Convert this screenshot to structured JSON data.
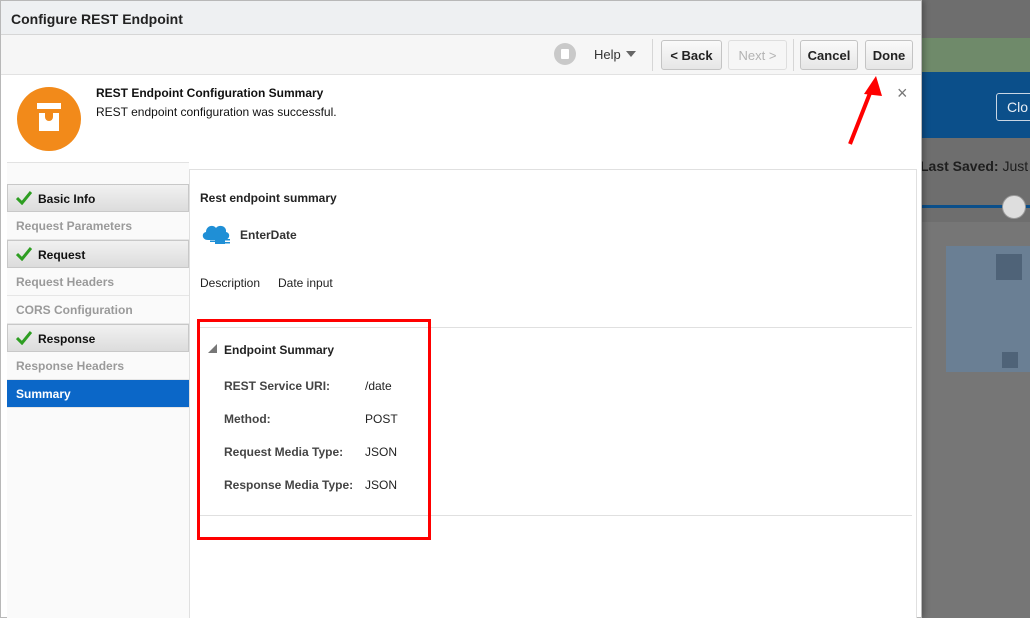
{
  "background": {
    "close_label": "Clo",
    "last_saved_label": "Last Saved:",
    "last_saved_value": "Just n"
  },
  "dialog": {
    "title": "Configure REST Endpoint"
  },
  "toolbar": {
    "help_label": "Help",
    "back_label": "< Back",
    "next_label": "Next >",
    "cancel_label": "Cancel",
    "done_label": "Done"
  },
  "message": {
    "title": "REST Endpoint Configuration Summary",
    "text": "REST endpoint configuration was successful.",
    "close_symbol": "×"
  },
  "sidebar": {
    "items": [
      {
        "label": "Basic Info",
        "state": "done"
      },
      {
        "label": "Request Parameters",
        "state": "pending"
      },
      {
        "label": "Request",
        "state": "done"
      },
      {
        "label": "Request Headers",
        "state": "pending"
      },
      {
        "label": "CORS Configuration",
        "state": "pending"
      },
      {
        "label": "Response",
        "state": "done"
      },
      {
        "label": "Response Headers",
        "state": "pending"
      },
      {
        "label": "Summary",
        "state": "active"
      }
    ]
  },
  "content": {
    "heading": "Rest endpoint summary",
    "endpoint_name": "EnterDate",
    "description_label": "Description",
    "description_value": "Date input",
    "section_title": "Endpoint Summary",
    "rows": [
      {
        "label": "REST Service URI:",
        "value": "/date"
      },
      {
        "label": "Method:",
        "value": "POST"
      },
      {
        "label": "Request Media Type:",
        "value": "JSON"
      },
      {
        "label": "Response Media Type:",
        "value": "JSON"
      }
    ]
  },
  "colors": {
    "accent_blue": "#0b67c8",
    "warning_orange": "#f28a1a",
    "annotation_red": "#ff0000",
    "check_green": "#2e9e22"
  }
}
